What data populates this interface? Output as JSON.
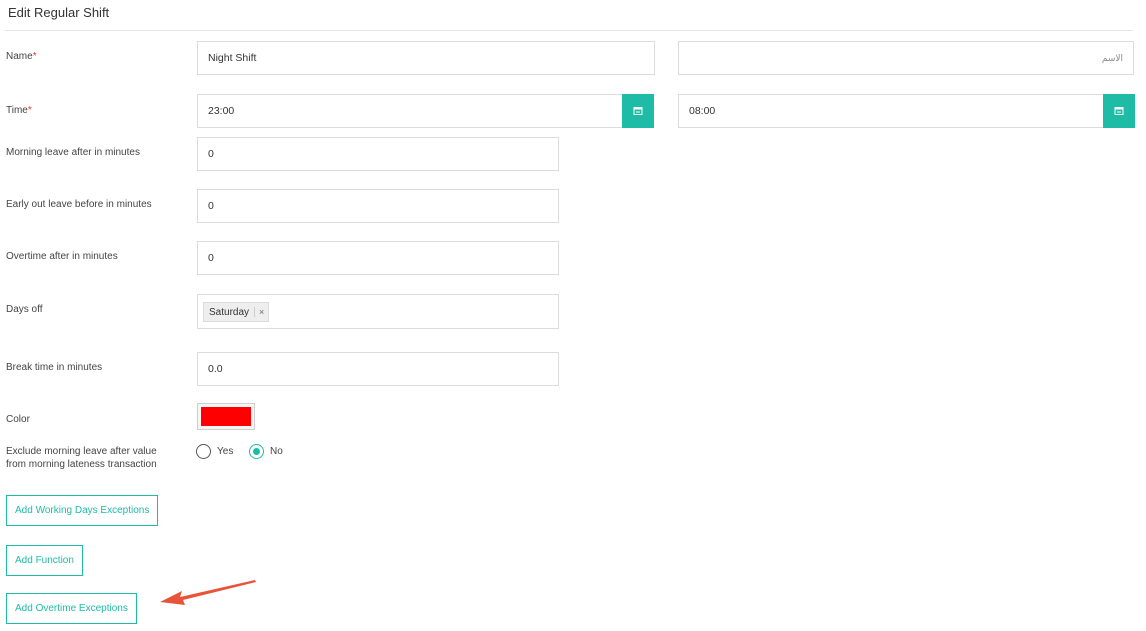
{
  "form": {
    "title": "Edit Regular Shift",
    "required_mark": "*",
    "name": {
      "label": "Name",
      "value": "Night Shift",
      "value_ar_placeholder": "الاسم"
    },
    "time": {
      "label": "Time",
      "start": "23:00",
      "end": "08:00"
    },
    "morning_leave": {
      "label": "Morning leave after in minutes",
      "value": "0"
    },
    "early_out": {
      "label": "Early out leave before in minutes",
      "value": "0"
    },
    "overtime": {
      "label": "Overtime after in minutes",
      "value": "0"
    },
    "days_off": {
      "label": "Days off",
      "selected": [
        "Saturday"
      ],
      "remove_glyph": "×"
    },
    "break_time": {
      "label": "Break time in minutes",
      "value": "0.0"
    },
    "color": {
      "label": "Color",
      "value": "#ff0000"
    },
    "exclude": {
      "label_line1": "Exclude morning leave after value",
      "label_line2": "from morning lateness transaction",
      "options": [
        "Yes",
        "No"
      ],
      "selected": "No"
    }
  },
  "buttons": {
    "working_days": "Add Working Days Exceptions",
    "function": "Add Function",
    "overtime_exceptions": "Add Overtime Exceptions"
  },
  "theme": {
    "accent": "#1ebca6",
    "annotation_arrow": "#e8533a"
  },
  "icons": {
    "calendar": "calendar-icon",
    "arrow": "annotation-arrow"
  }
}
